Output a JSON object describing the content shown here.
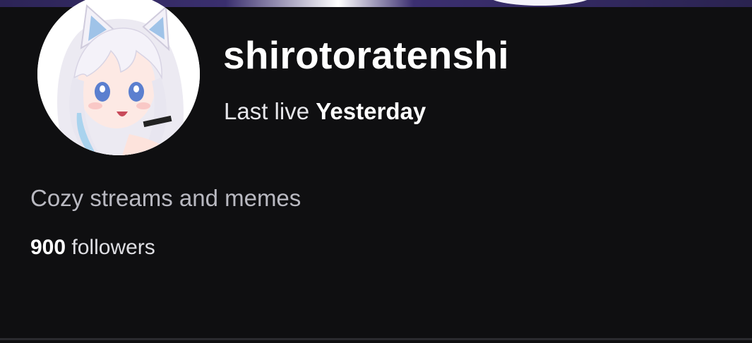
{
  "profile": {
    "username": "shirotoratenshi",
    "last_live_label": "Last live",
    "last_live_value": "Yesterday",
    "bio": "Cozy streams and memes",
    "followers_count": "900",
    "followers_label": "followers",
    "avatar_icon": "anime-avatar-icon"
  },
  "colors": {
    "background": "#0f0f11",
    "banner": "#3a2f6e",
    "text_primary": "#ffffff",
    "text_secondary": "#b9b9c1"
  }
}
